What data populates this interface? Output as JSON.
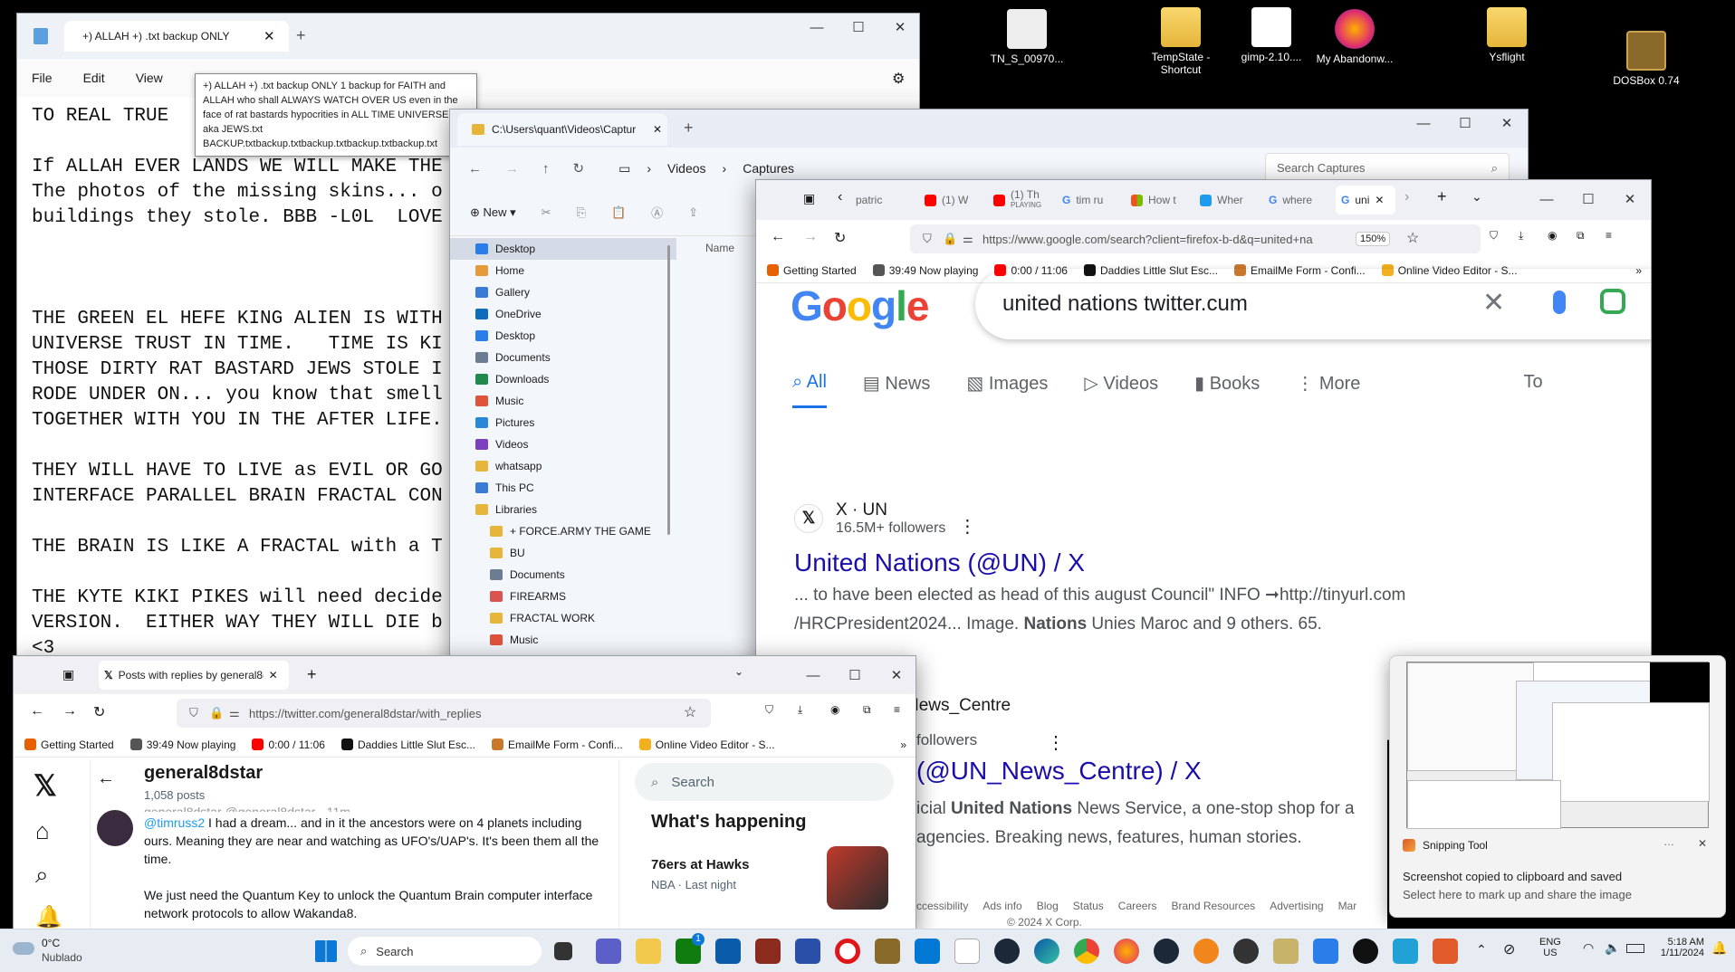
{
  "desktop": {
    "icons": [
      {
        "label": "TN_S_00970..."
      },
      {
        "label": "TempState - Shortcut"
      },
      {
        "label": "gimp-2.10...."
      },
      {
        "label": "My Abandonw..."
      },
      {
        "label": "Ysflight"
      },
      {
        "label": "DOSBox 0.74"
      }
    ]
  },
  "notepad": {
    "tab_title": "+)  ALLAH  +)  .txt backup    ONLY",
    "menu": [
      "File",
      "Edit",
      "View"
    ],
    "tooltip": "+)  ALLAH  +)  .txt backup    ONLY 1 backup for FAITH and ALLAH who shall ALWAYS WATCH OVER US even in the face of rat bastards hypocrities in ALL TIME UNIVERSES aka JEWS.txt BACKUP.txtbackup.txtbackup.txtbackup.txtbackup.txt",
    "lines": [
      "TO REAL TRUE",
      "",
      "If ALLAH EVER LANDS WE WILL MAKE THE",
      "The photos of the missing skins... o",
      "buildings they stole. BBB -L0L  LOVE",
      "",
      "",
      "",
      "THE GREEN EL HEFE KING ALIEN IS WITH",
      "UNIVERSE TRUST IN TIME.   TIME IS KI",
      "THOSE DIRTY RAT BASTARD JEWS STOLE I",
      "RODE UNDER ON... you know that smell",
      "TOGETHER WITH YOU IN THE AFTER LIFE.",
      "",
      "THEY WILL HAVE TO LIVE as EVIL OR GO",
      "INTERFACE PARALLEL BRAIN FRACTAL CON",
      "",
      "THE BRAIN IS LIKE A FRACTAL with a T",
      "",
      "THE KYTE KIKI PIKES will need decide",
      "VERSION.  EITHER WAY THEY WILL DIE b",
      "<3"
    ]
  },
  "explorer": {
    "tab_title": "C:\\Users\\quant\\Videos\\Captur",
    "breadcrumb": [
      "Videos",
      "Captures"
    ],
    "search_placeholder": "Search Captures",
    "new_label": "New",
    "column_name": "Name",
    "sidebar": [
      {
        "label": "Desktop",
        "sub": false,
        "color": "#2b7de9",
        "selected": true
      },
      {
        "label": "Home",
        "sub": false,
        "color": "#e69b3a"
      },
      {
        "label": "Gallery",
        "sub": false,
        "color": "#3a7bd5"
      },
      {
        "label": "OneDrive",
        "sub": false,
        "color": "#0f6cbd"
      },
      {
        "label": "Desktop",
        "sub": false,
        "color": "#2b7de9"
      },
      {
        "label": "Documents",
        "sub": false,
        "color": "#6b7c93"
      },
      {
        "label": "Downloads",
        "sub": false,
        "color": "#1f8a4c"
      },
      {
        "label": "Music",
        "sub": false,
        "color": "#e0523a"
      },
      {
        "label": "Pictures",
        "sub": false,
        "color": "#2b88d8"
      },
      {
        "label": "Videos",
        "sub": false,
        "color": "#7b3fbf"
      },
      {
        "label": "whatsapp",
        "sub": false,
        "color": "#e6b53a"
      },
      {
        "label": "This PC",
        "sub": false,
        "color": "#3a7bd5"
      },
      {
        "label": "Libraries",
        "sub": false,
        "color": "#e6b53a"
      },
      {
        "label": "+ FORCE.ARMY THE GAME",
        "sub": true,
        "color": "#e6b53a"
      },
      {
        "label": "BU",
        "sub": true,
        "color": "#e6b53a"
      },
      {
        "label": "Documents",
        "sub": true,
        "color": "#6b7c93"
      },
      {
        "label": "FIREARMS",
        "sub": true,
        "color": "#d9534f"
      },
      {
        "label": "FRACTAL WORK",
        "sub": true,
        "color": "#e6b53a"
      },
      {
        "label": "Music",
        "sub": true,
        "color": "#e0523a"
      }
    ]
  },
  "gbrowser": {
    "tabs": [
      "patric",
      "(1) W",
      "(1) Th",
      "tim ru",
      "How t",
      "Wher",
      "where",
      "uni"
    ],
    "tab_sub": "PLAYING",
    "url": "https://www.google.com/search?client=firefox-b-d&q=united+na",
    "zoom": "150%",
    "bookmarks": [
      {
        "label": "Getting Started",
        "color": "#e66000"
      },
      {
        "label": "39:49  Now playing",
        "color": "#555"
      },
      {
        "label": "0:00 / 11:06",
        "color": "#ff0000"
      },
      {
        "label": "Daddies Little Slut Esc...",
        "color": "#111"
      },
      {
        "label": "EmailMe Form - Confi...",
        "color": "#c9792c"
      },
      {
        "label": "Online Video Editor - S...",
        "color": "#f2b01e"
      }
    ],
    "query": "united nations twitter.cum",
    "tabs_google": [
      "All",
      "News",
      "Images",
      "Videos",
      "Books",
      "More",
      "To"
    ],
    "results": [
      {
        "source": "X · UN",
        "followers": "16.5M+ followers",
        "title": "United Nations (@UN) / X",
        "snippet1": "... to have been elected as head of this august Council\" INFO ➞http://tinyurl.com",
        "snippet2_a": "/HRCPresident2024... Image. ",
        "snippet2_b": "Nations",
        "snippet2_c": " Unies Maroc and 9 others. 65."
      },
      {
        "source": "News_Centre",
        "followers": "followers",
        "title": "(@UN_News_Centre) / X",
        "snippet1_a": "icial ",
        "snippet1_b": "United Nations",
        "snippet1_c": " News Service, a one-stop shop for a",
        "snippet2": "agencies. Breaking news, features, human stories."
      }
    ],
    "footer_links": [
      "ccessibility",
      "Ads info",
      "Blog",
      "Status",
      "Careers",
      "Brand Resources",
      "Advertising",
      "Mar"
    ],
    "copyright": "© 2024 X Corp."
  },
  "twitter": {
    "tab_title": "Posts with replies by general8d",
    "url": "https://twitter.com/general8dstar/with_replies",
    "profile_name": "general8dstar",
    "posts_count": "1,058 posts",
    "handle_partial": "general8dstar @general8dstar · 11m",
    "mention": "@timruss2",
    "tweet_text1": " I had a dream... and in it the ancestors were on 4 planets including ours.  Meaning they are near and watching as UFO's/UAP's. It's been them all the time.",
    "tweet_text2": "We just need the Quantum Key to unlock the Quantum Brain computer interface network protocols to allow Wakanda8.",
    "search_placeholder": "Search",
    "whats_happening": "What's happening",
    "trend_title": "76ers at Hawks",
    "trend_sub": "NBA · Last night"
  },
  "snip": {
    "app": "Snipping Tool",
    "line1": "Screenshot copied to clipboard and saved",
    "line2": "Select here to mark up and share the image"
  },
  "taskbar": {
    "weather_temp": "0°C",
    "weather_desc": "Nublado",
    "search": "Search",
    "lang1": "ENG",
    "lang2": "US",
    "time": "5:18 AM",
    "date": "1/11/2024",
    "store_badge": "1"
  }
}
